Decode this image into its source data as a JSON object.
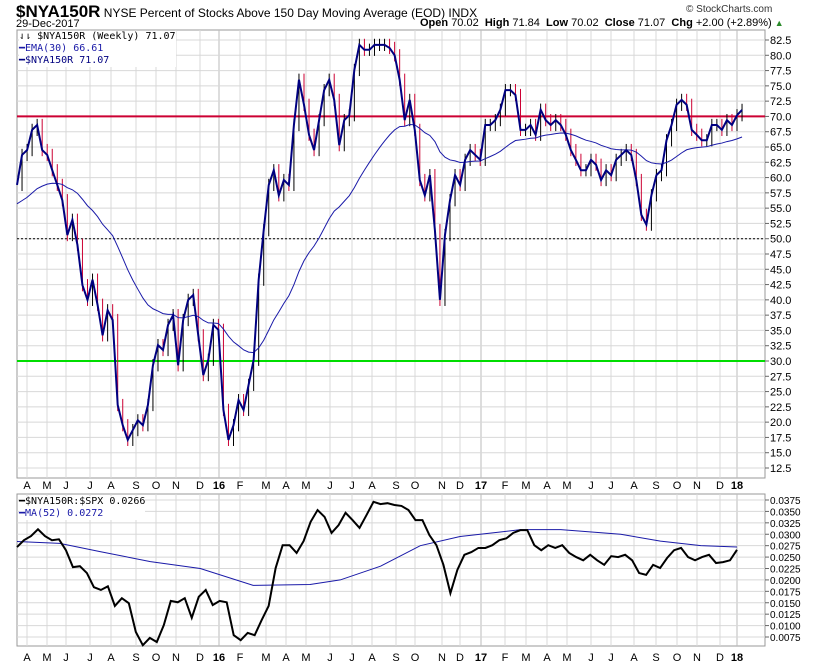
{
  "header": {
    "symbol": "$NYA150R",
    "description": "NYSE Percent of Stocks Above 150 Day Moving Average (EOD)",
    "exchange": "INDX",
    "date": "29-Dec-2017",
    "copyright": "© StockCharts.com",
    "open_label": "Open",
    "open": "70.02",
    "high_label": "High",
    "high": "71.84",
    "low_label": "Low",
    "low": "70.02",
    "close_label": "Close",
    "close": "71.07",
    "chg_label": "Chg",
    "chg": "+2.00 (+2.89%)",
    "chg_icon": "up-triangle-icon"
  },
  "legend_upper": [
    "$NYA150R (Weekly) 71.07",
    "EMA(30) 66.61",
    "$NYA150R 71.07"
  ],
  "legend_lower": [
    "$NYA150R:$SPX 0.0266",
    "MA(52) 0.0272"
  ],
  "colors": {
    "price": "#000080",
    "ema": "#1a1aa8",
    "ratio": "#000000",
    "ma": "#1a1aa8",
    "line70": "#cc0033",
    "line30": "#00dd00",
    "grid": "#d8d8d8"
  },
  "chart_data": [
    {
      "type": "line",
      "title": "$NYA150R (Weekly)",
      "ylim": [
        10,
        85
      ],
      "yticks": [
        "82.5",
        "80.0",
        "77.5",
        "75.0",
        "72.5",
        "70.0",
        "67.5",
        "65.0",
        "62.5",
        "60.0",
        "57.5",
        "55.0",
        "52.5",
        "50.0",
        "47.5",
        "45.0",
        "42.5",
        "40.0",
        "37.5",
        "35.0",
        "32.5",
        "30.0",
        "27.5",
        "25.0",
        "22.5",
        "20.0",
        "17.5",
        "15.0",
        "12.5"
      ],
      "reference_lines": [
        {
          "value": 70,
          "color": "red"
        },
        {
          "value": 50,
          "style": "dotted"
        },
        {
          "value": 30,
          "color": "green"
        }
      ],
      "ema_period": 30,
      "ema_seed": 55.5,
      "close": [
        58.8,
        63.7,
        64.5,
        67.8,
        68.6,
        64.5,
        63.7,
        61.2,
        58.8,
        56.3,
        50.6,
        53.1,
        49,
        42.4,
        40,
        43.3,
        39.2,
        34.2,
        38.3,
        36.7,
        22.8,
        19.5,
        17.1,
        18.7,
        20.3,
        19.5,
        22.8,
        29.3,
        32.6,
        31.8,
        35.9,
        37.5,
        29.3,
        36.7,
        40,
        40.8,
        34.2,
        27.7,
        30.2,
        35.9,
        35.1,
        22,
        17.1,
        19.5,
        23.6,
        22,
        26.1,
        30.2,
        43.3,
        51.4,
        58.8,
        61.2,
        57.1,
        59.6,
        58.8,
        68.6,
        76,
        71.9,
        67,
        64.5,
        69.4,
        74.3,
        76,
        72.7,
        65.3,
        69.4,
        70.2,
        77.6,
        81.7,
        80.9,
        80.9,
        81.7,
        81.7,
        81.7,
        81.2,
        80,
        76,
        69.4,
        72.7,
        67.8,
        59.6,
        57.1,
        60.4,
        51.4,
        40,
        50.6,
        56.3,
        60.4,
        58.8,
        62.9,
        64.5,
        63.7,
        62.9,
        68.6,
        68.6,
        69.4,
        71.1,
        74.3,
        74.3,
        73.5,
        67.8,
        67.8,
        68.6,
        67,
        71.1,
        69.4,
        68.6,
        69.4,
        68.6,
        67,
        64.5,
        62.9,
        61.2,
        61.2,
        62.9,
        62.1,
        59.6,
        61.2,
        60.4,
        62.9,
        63.7,
        64.5,
        63.7,
        59.6,
        53.9,
        52.3,
        57.1,
        60.4,
        61.2,
        66.1,
        68.6,
        71.9,
        72.7,
        71.9,
        67.8,
        67,
        66.1,
        66.1,
        68.6,
        68.6,
        67.8,
        69.4,
        68.6,
        70.2,
        71.07
      ]
    },
    {
      "type": "line",
      "title": "$NYA150R:$SPX",
      "ylim": [
        0.0065,
        0.0385
      ],
      "yticks": [
        "0.0375",
        "0.0350",
        "0.0325",
        "0.0300",
        "0.0275",
        "0.0250",
        "0.0225",
        "0.0200",
        "0.0175",
        "0.0150",
        "0.0125",
        "0.0100",
        "0.0075"
      ],
      "ratio": [
        0.0272,
        0.0287,
        0.0296,
        0.0311,
        0.0296,
        0.0287,
        0.0289,
        0.0265,
        0.0228,
        0.023,
        0.0215,
        0.0184,
        0.0178,
        0.0186,
        0.0143,
        0.016,
        0.0149,
        0.0086,
        0.0057,
        0.0073,
        0.0064,
        0.0101,
        0.0154,
        0.0151,
        0.016,
        0.0117,
        0.0163,
        0.0178,
        0.0145,
        0.0154,
        0.0151,
        0.0079,
        0.0068,
        0.0084,
        0.0079,
        0.0112,
        0.0143,
        0.0226,
        0.0276,
        0.0276,
        0.0259,
        0.0285,
        0.0327,
        0.0353,
        0.0338,
        0.0303,
        0.032,
        0.0347,
        0.0331,
        0.0314,
        0.0342,
        0.0371,
        0.0366,
        0.0368,
        0.0364,
        0.0362,
        0.0353,
        0.0331,
        0.0331,
        0.0298,
        0.0276,
        0.0233,
        0.0171,
        0.0222,
        0.0255,
        0.0261,
        0.027,
        0.027,
        0.0276,
        0.0287,
        0.0291,
        0.0303,
        0.0309,
        0.0309,
        0.0276,
        0.0265,
        0.0276,
        0.027,
        0.0276,
        0.0259,
        0.025,
        0.0243,
        0.0255,
        0.0243,
        0.0233,
        0.0252,
        0.025,
        0.0255,
        0.0243,
        0.0215,
        0.0211,
        0.0233,
        0.0226,
        0.0248,
        0.0265,
        0.027,
        0.025,
        0.0243,
        0.025,
        0.0255,
        0.0237,
        0.0239,
        0.0243,
        0.0266
      ],
      "ma52": [
        {
          "week": 0,
          "value": 0.0284
        },
        {
          "week": 8.5,
          "value": 0.028
        },
        {
          "week": 16.5,
          "value": 0.0262
        },
        {
          "week": 26.5,
          "value": 0.024
        },
        {
          "week": 36.4,
          "value": 0.0225
        },
        {
          "week": 46.9,
          "value": 0.0188
        },
        {
          "week": 58.2,
          "value": 0.019
        },
        {
          "week": 64.2,
          "value": 0.02
        },
        {
          "week": 72.2,
          "value": 0.023
        },
        {
          "week": 80.1,
          "value": 0.0275
        },
        {
          "week": 88,
          "value": 0.0295
        },
        {
          "week": 96,
          "value": 0.0305
        },
        {
          "week": 100,
          "value": 0.031
        },
        {
          "week": 108,
          "value": 0.031
        },
        {
          "week": 119.9,
          "value": 0.03
        },
        {
          "week": 127.8,
          "value": 0.0285
        },
        {
          "week": 135.8,
          "value": 0.0275
        },
        {
          "week": 143,
          "value": 0.0272
        }
      ]
    },
    {
      "type": "axis",
      "x_tick_labels": [
        "A",
        "M",
        "J",
        "J",
        "A",
        "S",
        "O",
        "N",
        "D",
        "16",
        "F",
        "M",
        "A",
        "M",
        "J",
        "J",
        "A",
        "S",
        "O",
        "N",
        "D",
        "17",
        "F",
        "M",
        "A",
        "M",
        "J",
        "J",
        "A",
        "S",
        "O",
        "N",
        "D",
        "18"
      ]
    }
  ]
}
